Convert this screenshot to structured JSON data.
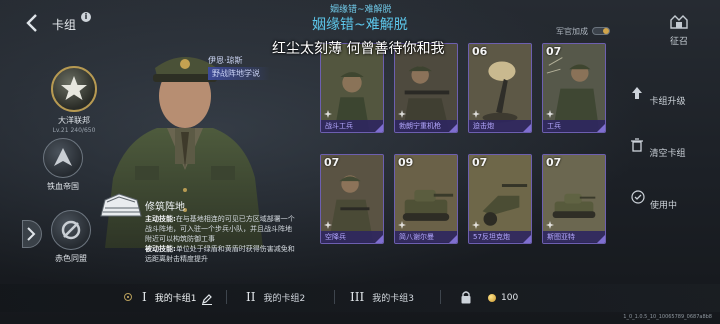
{
  "header": {
    "title": "卡组",
    "song_small": "姻缘错~难解脱",
    "song_big": "姻缘错~难解脱",
    "lyric": "红尘太刻薄 何曾善待你和我",
    "army_bonus_label": "军官加成",
    "conquest_label": "征召"
  },
  "factions": [
    {
      "name": "大洋联邦",
      "level": "Lv.21  240/650"
    },
    {
      "name": "铁血帝国"
    },
    {
      "name": "赤色同盟"
    }
  ],
  "commander": {
    "name": "伊恩·琼斯",
    "title": "野战阵地学说"
  },
  "skill": {
    "name": "修筑阵地",
    "active_label": "主动技能:",
    "active_text": "在与基地相连的可见已方区域部署一个战斗阵地，可入驻一个步兵小队，并且战斗阵地附近可以构筑防御工事",
    "passive_label": "被动技能:",
    "passive_text": "单位处于绿盾和黄盾时获得伤害减免和远距离射击精度提升"
  },
  "cards": [
    {
      "cost": "",
      "name": "战斗工兵"
    },
    {
      "cost": "",
      "name": "勃朗宁重机枪"
    },
    {
      "cost": "06",
      "name": "迫击炮"
    },
    {
      "cost": "07",
      "name": "工兵"
    },
    {
      "cost": "07",
      "name": "空降兵"
    },
    {
      "cost": "09",
      "name": "简八谢尔曼"
    },
    {
      "cost": "07",
      "name": "57反坦克炮"
    },
    {
      "cost": "07",
      "name": "斯图亚特"
    }
  ],
  "right_menu": {
    "upgrade": "卡组升级",
    "clear": "清空卡组",
    "in_use": "使用中"
  },
  "decks": [
    {
      "roman": "I",
      "label": "我的卡组1"
    },
    {
      "roman": "II",
      "label": "我的卡组2"
    },
    {
      "roman": "III",
      "label": "我的卡组3"
    }
  ],
  "currency": {
    "value": "100"
  },
  "version": "1_0_1.0.5_10_10065789_0687a8b8",
  "colors": {
    "accent": "#5cc6ea",
    "card_border": "#6d5fb0",
    "card_name": "#b4a8ff",
    "gold": "#c9962e"
  }
}
